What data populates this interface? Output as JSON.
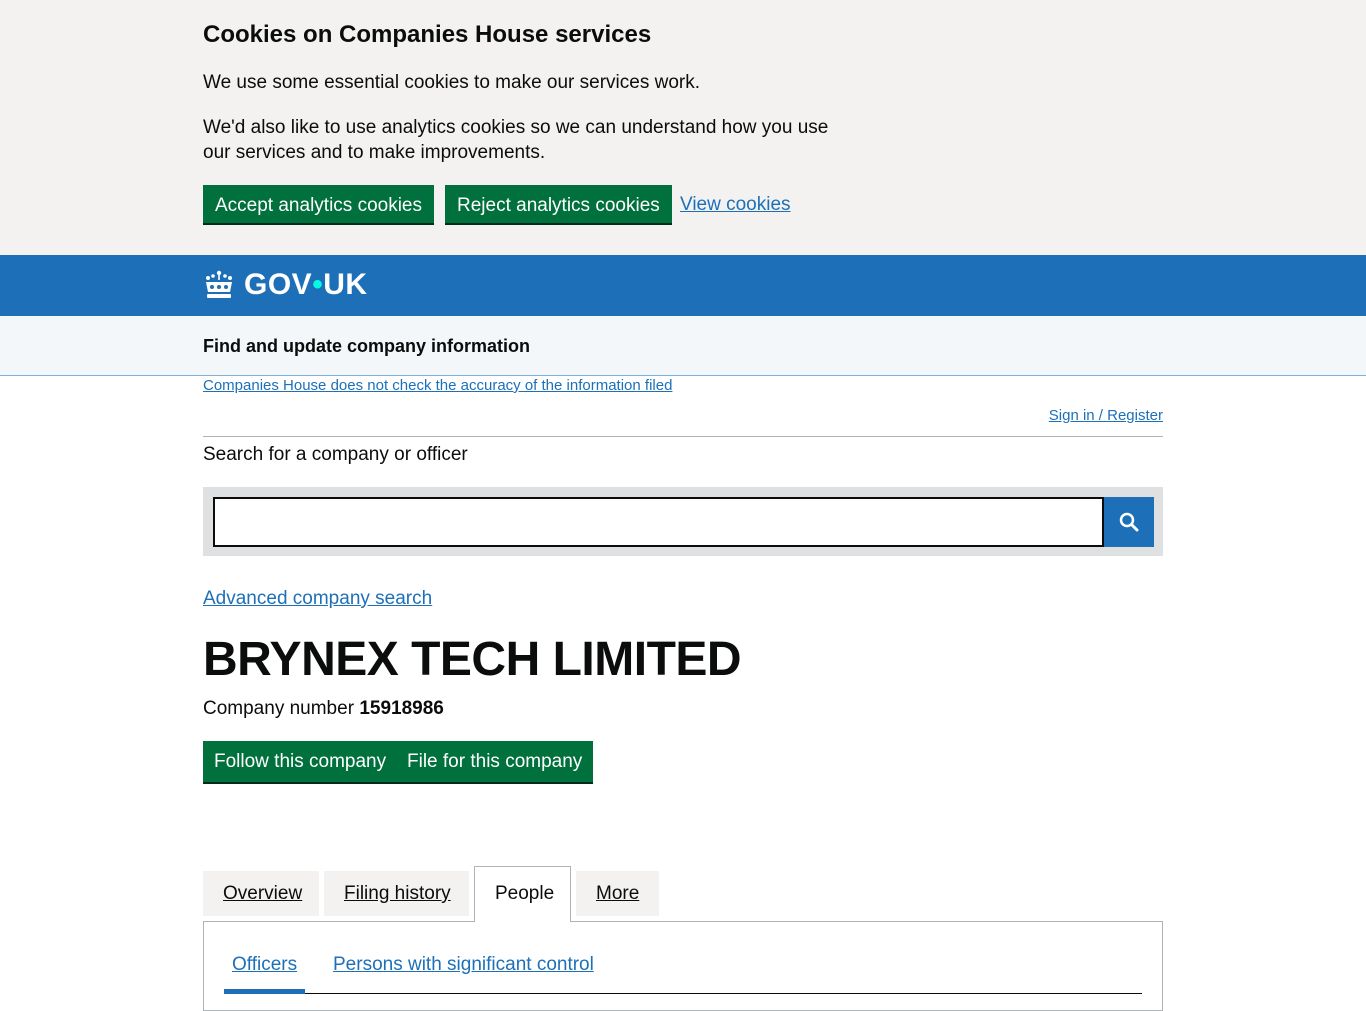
{
  "cookie_banner": {
    "title": "Cookies on Companies House services",
    "paragraph1": "We use some essential cookies to make our services work.",
    "paragraph2": "We'd also like to use analytics cookies so we can understand how you use our services and to make improvements.",
    "accept_label": "Accept analytics cookies",
    "reject_label": "Reject analytics cookies",
    "view_label": "View cookies"
  },
  "header": {
    "logo_text_left": "GOV",
    "logo_dot": "•",
    "logo_text_right": "UK",
    "logo_icon": "crown-icon"
  },
  "service": {
    "name": "Find and update company information"
  },
  "notice": {
    "accuracy_link": "Companies House does not check the accuracy of the information filed",
    "signin_link": "Sign in / Register"
  },
  "search": {
    "label": "Search for a company or officer",
    "value": "",
    "icon": "search-icon",
    "advanced_link": "Advanced company search"
  },
  "company": {
    "name": "BRYNEX TECH LIMITED",
    "number_label": "Company number",
    "number": "15918986",
    "follow_label": "Follow this company",
    "file_label": "File for this company"
  },
  "tabs": [
    {
      "label": "Overview",
      "active": false
    },
    {
      "label": "Filing history",
      "active": false
    },
    {
      "label": "People",
      "active": true
    },
    {
      "label": "More",
      "active": false
    }
  ],
  "subnav": [
    {
      "label": "Officers",
      "active": true
    },
    {
      "label": "Persons with significant control",
      "active": false
    }
  ],
  "colors": {
    "brand_blue": "#1d70b8",
    "button_green": "#00703c",
    "banner_bg": "#f3f2f1",
    "logo_dot": "#00ffe0"
  }
}
